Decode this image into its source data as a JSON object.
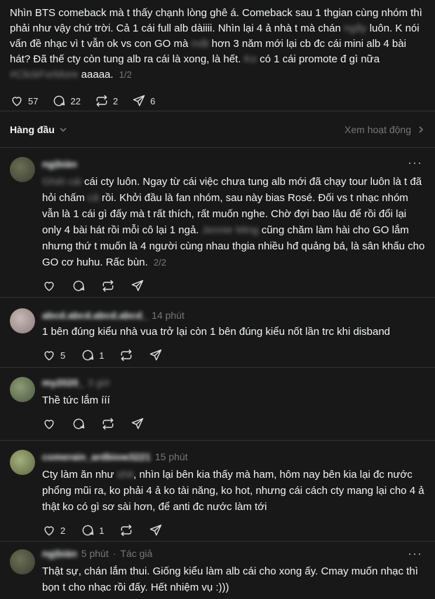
{
  "post": {
    "text_part1": "Nhìn BTS comeback mà t thấy chạnh lòng ghê á. Comeback sau 1 thgian cùng nhóm thì phải như vậy chứ trời. Cả 1 cái full alb dàiiii. Nhìn lại 4 ả nhà t mà chán ",
    "blur1": "ngấy",
    "text_part2": " luôn. K nói vấn đề nhạc vì t vẫn ok vs con GO mà ",
    "blur2": "mất",
    "text_part3": " hơn 3 năm mới lại cb đc cái mini alb 4 bài hát? Đã thế cty còn tung alb ra cái là xong, là hết. ",
    "blur3": "Ko",
    "text_part4": " có 1 cái promote đ gì nữa ",
    "blur4": "#ClickForMore",
    "text_part5": " aaaaa.",
    "pager": "1/2",
    "likes": "57",
    "comments": "22",
    "reposts": "2",
    "shares": "6"
  },
  "sort": {
    "label": "Hàng đầu",
    "view_activity": "Xem hoạt động"
  },
  "comments": [
    {
      "user": "ngịbián",
      "time": "",
      "blur_lead": "Ghét cái",
      "text": "cái cty luôn. Ngay từ cái việc chưa tung alb mới đã chạy tour luôn là t đã hỏi chấm ",
      "blur_mid": "cả",
      "text2": " rồi. Khởi đầu là fan nhóm, sau này bias Rosé. Đối vs t nhạc nhóm vẫn là 1 cái gì đấy mà t rất thích, rất muốn nghe. Chờ đợi bao lâu để rồi đổi lại only 4 bài hát rồi mỗi cô lại 1 ngả. ",
      "blur_mid2": "Jennie Ming",
      "text3": " cũng chăm làm hài cho GO lắm nhưng thứ t muốn là 4 người cùng nhau thgia nhiều hđ quảng bá, là sân khấu cho GO cơ huhu. Rấc bùn.",
      "pager": "2/2",
      "likes": "",
      "replies": ""
    },
    {
      "user": "abcd.abcd.abcd.abcd_",
      "time": "14 phút",
      "text": "1 bên đúng kiểu nhà vua trở lại còn 1 bên đúng kiểu nốt lần trc khi disband",
      "likes": "5",
      "replies": "1"
    },
    {
      "user": "my2020_",
      "time": "3 giờ",
      "text": "Thề tức lắm ííí",
      "likes": "",
      "replies": ""
    },
    {
      "user": "comerain_ardbiow3221",
      "time": "15 phút",
      "text": "Cty làm ăn như ",
      "blur_mid": "shit",
      "text2": ", nhìn lại bên kia thấy mà ham, hôm nay bên kia lại đc nước phổng mũi ra, ko phải 4 ả ko tài năng, ko hot, nhưng cái cách cty mang lại cho 4 ả thật ko có gì sơ sài hơn, để anti đc nước làm tới",
      "likes": "2",
      "replies": "1"
    },
    {
      "user": "ngịbián",
      "time": "5 phút",
      "author_tag": "Tác giả",
      "text": "Thật sự, chán lắm thui. Giống kiểu làm alb cái cho xong ấy. Cmay muốn nhạc thì bọn t cho nhạc rồi đấy. Hết nhiệm vụ :)))"
    }
  ],
  "colors": {
    "background": "#181818",
    "text": "#f3f5f7",
    "muted": "#777777",
    "separator": "#333333"
  }
}
